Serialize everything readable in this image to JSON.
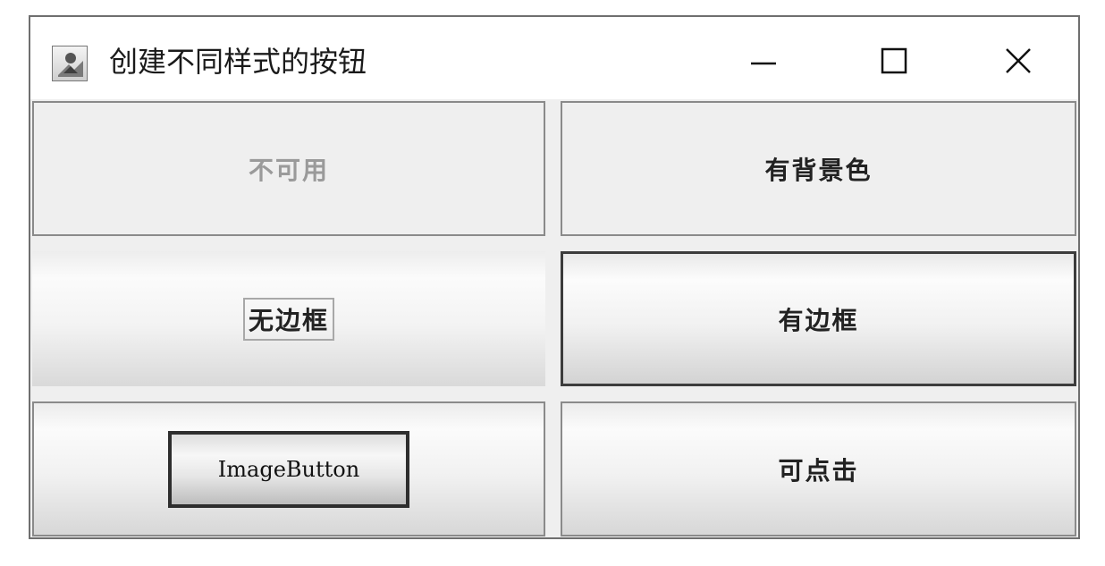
{
  "window": {
    "title": "创建不同样式的按钮",
    "icon": "java-app-icon",
    "controls": {
      "minimize": "minimize-icon",
      "maximize": "maximize-icon",
      "close": "close-icon"
    }
  },
  "buttons": {
    "disabled_label": "不可用",
    "background_label": "有背景色",
    "no_border_label": "无边框",
    "border_label": "有边框",
    "image_label": "ImageButton",
    "clickable_label": "可点击"
  },
  "states": {
    "disabled_enabled": false
  },
  "colors": {
    "disabled_text": "#9a9a9a",
    "text": "#222222",
    "border_dark": "#3c3c3c"
  }
}
